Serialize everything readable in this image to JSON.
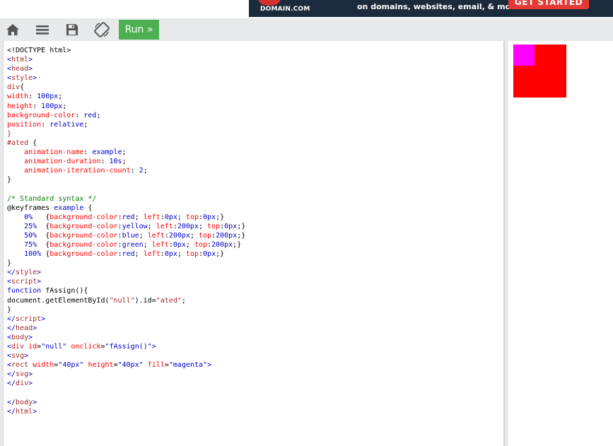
{
  "ad": {
    "brand": "DOMAIN.COM",
    "tagline": "on domains, websites, email, & more",
    "cta": "GET STARTED"
  },
  "toolbar": {
    "home_icon": "home-icon",
    "menu_icon": "menu-icon",
    "save_icon": "save-icon",
    "rotate_icon": "rotate-icon",
    "run_label": "Run »"
  },
  "editor": {
    "lines": [
      [
        [
          "plain",
          "<!DOCTYPE html>"
        ]
      ],
      [
        [
          "bracket",
          "<"
        ],
        [
          "tag",
          "html"
        ],
        [
          "bracket",
          ">"
        ]
      ],
      [
        [
          "bracket",
          "<"
        ],
        [
          "tag",
          "head"
        ],
        [
          "bracket",
          ">"
        ]
      ],
      [
        [
          "bracket",
          "<"
        ],
        [
          "tag",
          "style"
        ],
        [
          "bracket",
          ">"
        ]
      ],
      [
        [
          "tag",
          "div"
        ],
        [
          "plain",
          "{"
        ]
      ],
      [
        [
          "prop",
          "width"
        ],
        [
          "plain",
          ": "
        ],
        [
          "val",
          "100px"
        ],
        [
          "plain",
          ";"
        ]
      ],
      [
        [
          "prop",
          "height"
        ],
        [
          "plain",
          ": "
        ],
        [
          "val",
          "100px"
        ],
        [
          "plain",
          ";"
        ]
      ],
      [
        [
          "prop",
          "background-color"
        ],
        [
          "plain",
          ": "
        ],
        [
          "val",
          "red"
        ],
        [
          "plain",
          ";"
        ]
      ],
      [
        [
          "prop",
          "position"
        ],
        [
          "plain",
          ": "
        ],
        [
          "val",
          "relative"
        ],
        [
          "plain",
          ";"
        ]
      ],
      [
        [
          "tag",
          "}"
        ]
      ],
      [
        [
          "tag",
          "#ated"
        ],
        [
          "plain",
          " {"
        ]
      ],
      [
        [
          "plain",
          "    "
        ],
        [
          "prop",
          "animation-name"
        ],
        [
          "plain",
          ": "
        ],
        [
          "val",
          "example"
        ],
        [
          "plain",
          ";"
        ]
      ],
      [
        [
          "plain",
          "    "
        ],
        [
          "prop",
          "animation-duration"
        ],
        [
          "plain",
          ": "
        ],
        [
          "val",
          "10s"
        ],
        [
          "plain",
          ";"
        ]
      ],
      [
        [
          "plain",
          "    "
        ],
        [
          "prop",
          "animation-iteration-count"
        ],
        [
          "plain",
          ": "
        ],
        [
          "val",
          "2"
        ],
        [
          "plain",
          ";"
        ]
      ],
      [
        [
          "plain",
          "}"
        ]
      ],
      [
        [
          "plain",
          ""
        ]
      ],
      [
        [
          "com",
          "/* Standard syntax */"
        ]
      ],
      [
        [
          "plain",
          "@keyframes "
        ],
        [
          "val",
          "example"
        ],
        [
          "plain",
          " {"
        ]
      ],
      [
        [
          "plain",
          "    "
        ],
        [
          "val",
          "0%"
        ],
        [
          "plain",
          "   {"
        ],
        [
          "prop",
          "background-color"
        ],
        [
          "plain",
          ":"
        ],
        [
          "val",
          "red"
        ],
        [
          "plain",
          "; "
        ],
        [
          "prop",
          "left"
        ],
        [
          "plain",
          ":"
        ],
        [
          "val",
          "0px"
        ],
        [
          "plain",
          "; "
        ],
        [
          "prop",
          "top"
        ],
        [
          "plain",
          ":"
        ],
        [
          "val",
          "0px"
        ],
        [
          "plain",
          ";}"
        ]
      ],
      [
        [
          "plain",
          "    "
        ],
        [
          "val",
          "25%"
        ],
        [
          "plain",
          "  {"
        ],
        [
          "prop",
          "background-color"
        ],
        [
          "plain",
          ":"
        ],
        [
          "val",
          "yellow"
        ],
        [
          "plain",
          "; "
        ],
        [
          "prop",
          "left"
        ],
        [
          "plain",
          ":"
        ],
        [
          "val",
          "200px"
        ],
        [
          "plain",
          "; "
        ],
        [
          "prop",
          "top"
        ],
        [
          "plain",
          ":"
        ],
        [
          "val",
          "0px"
        ],
        [
          "plain",
          ";}"
        ]
      ],
      [
        [
          "plain",
          "    "
        ],
        [
          "val",
          "50%"
        ],
        [
          "plain",
          "  {"
        ],
        [
          "prop",
          "background-color"
        ],
        [
          "plain",
          ":"
        ],
        [
          "val",
          "blue"
        ],
        [
          "plain",
          "; "
        ],
        [
          "prop",
          "left"
        ],
        [
          "plain",
          ":"
        ],
        [
          "val",
          "200px"
        ],
        [
          "plain",
          "; "
        ],
        [
          "prop",
          "top"
        ],
        [
          "plain",
          ":"
        ],
        [
          "val",
          "200px"
        ],
        [
          "plain",
          ";}"
        ]
      ],
      [
        [
          "plain",
          "    "
        ],
        [
          "val",
          "75%"
        ],
        [
          "plain",
          "  {"
        ],
        [
          "prop",
          "background-color"
        ],
        [
          "plain",
          ":"
        ],
        [
          "val",
          "green"
        ],
        [
          "plain",
          "; "
        ],
        [
          "prop",
          "left"
        ],
        [
          "plain",
          ":"
        ],
        [
          "val",
          "0px"
        ],
        [
          "plain",
          "; "
        ],
        [
          "prop",
          "top"
        ],
        [
          "plain",
          ":"
        ],
        [
          "val",
          "200px"
        ],
        [
          "plain",
          ";}"
        ]
      ],
      [
        [
          "plain",
          "    "
        ],
        [
          "val",
          "100%"
        ],
        [
          "plain",
          " {"
        ],
        [
          "prop",
          "background-color"
        ],
        [
          "plain",
          ":"
        ],
        [
          "val",
          "red"
        ],
        [
          "plain",
          "; "
        ],
        [
          "prop",
          "left"
        ],
        [
          "plain",
          ":"
        ],
        [
          "val",
          "0px"
        ],
        [
          "plain",
          "; "
        ],
        [
          "prop",
          "top"
        ],
        [
          "plain",
          ":"
        ],
        [
          "val",
          "0px"
        ],
        [
          "plain",
          ";}"
        ]
      ],
      [
        [
          "plain",
          "}"
        ]
      ],
      [
        [
          "bracket",
          "</"
        ],
        [
          "tag",
          "style"
        ],
        [
          "bracket",
          ">"
        ]
      ],
      [
        [
          "bracket",
          "<"
        ],
        [
          "tag",
          "script"
        ],
        [
          "bracket",
          ">"
        ]
      ],
      [
        [
          "kw",
          "function"
        ],
        [
          "plain",
          " fAssign(){"
        ]
      ],
      [
        [
          "plain",
          "document.getElementById("
        ],
        [
          "str",
          "\"null\""
        ],
        [
          "plain",
          ").id="
        ],
        [
          "str",
          "\"ated\""
        ],
        [
          "plain",
          ";"
        ]
      ],
      [
        [
          "plain",
          "}"
        ]
      ],
      [
        [
          "bracket",
          "</"
        ],
        [
          "tag",
          "script"
        ],
        [
          "bracket",
          ">"
        ]
      ],
      [
        [
          "bracket",
          "</"
        ],
        [
          "tag",
          "head"
        ],
        [
          "bracket",
          ">"
        ]
      ],
      [
        [
          "bracket",
          "<"
        ],
        [
          "tag",
          "body"
        ],
        [
          "bracket",
          ">"
        ]
      ],
      [
        [
          "bracket",
          "<"
        ],
        [
          "tag",
          "div"
        ],
        [
          "plain",
          " "
        ],
        [
          "attr",
          "id"
        ],
        [
          "plain",
          "="
        ],
        [
          "val",
          "\"null\""
        ],
        [
          "plain",
          " "
        ],
        [
          "attr",
          "onclick"
        ],
        [
          "plain",
          "="
        ],
        [
          "val",
          "\"fAssign()\""
        ],
        [
          "bracket",
          ">"
        ]
      ],
      [
        [
          "bracket",
          "<"
        ],
        [
          "tag",
          "svg"
        ],
        [
          "bracket",
          ">"
        ]
      ],
      [
        [
          "bracket",
          "<"
        ],
        [
          "tag",
          "rect"
        ],
        [
          "plain",
          " "
        ],
        [
          "attr",
          "width"
        ],
        [
          "plain",
          "="
        ],
        [
          "val",
          "\"40px\""
        ],
        [
          "plain",
          " "
        ],
        [
          "attr",
          "height"
        ],
        [
          "plain",
          "="
        ],
        [
          "val",
          "\"40px\""
        ],
        [
          "plain",
          " "
        ],
        [
          "attr",
          "fill"
        ],
        [
          "plain",
          "="
        ],
        [
          "val",
          "\"magenta\""
        ],
        [
          "bracket",
          ">"
        ]
      ],
      [
        [
          "bracket",
          "</"
        ],
        [
          "tag",
          "svg"
        ],
        [
          "bracket",
          ">"
        ]
      ],
      [
        [
          "bracket",
          "</"
        ],
        [
          "tag",
          "div"
        ],
        [
          "bracket",
          ">"
        ]
      ],
      [
        [
          "plain",
          ""
        ]
      ],
      [
        [
          "bracket",
          "</"
        ],
        [
          "tag",
          "body"
        ],
        [
          "bracket",
          ">"
        ]
      ],
      [
        [
          "bracket",
          "</"
        ],
        [
          "tag",
          "html"
        ],
        [
          "bracket",
          ">"
        ]
      ]
    ]
  },
  "result": {
    "div_color": "#ff0000",
    "rect_color": "#ff00ff"
  },
  "colors": {
    "run_button": "#4caf50",
    "ad_background": "#1b2b3c",
    "ad_cta": "#e53935"
  }
}
